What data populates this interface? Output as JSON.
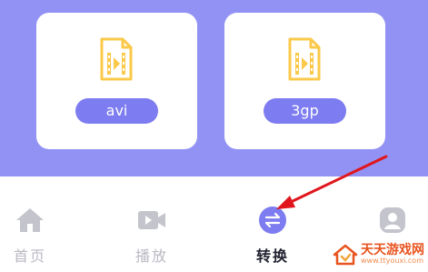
{
  "formats": [
    {
      "label": "avi",
      "icon": "video-file-icon"
    },
    {
      "label": "3gp",
      "icon": "video-file-icon"
    }
  ],
  "tabbar": {
    "items": [
      {
        "label": "首页",
        "icon": "home-icon"
      },
      {
        "label": "播放",
        "icon": "video-camera-icon"
      },
      {
        "label": "转换",
        "icon": "convert-icon",
        "active": true
      },
      {
        "label": "",
        "icon": "profile-icon"
      }
    ]
  },
  "watermark": {
    "text": "天天游戏网",
    "sub": "www.ttyouxi.com"
  },
  "colors": {
    "header_bg": "#9292f4",
    "pill_bg": "#7d7cf0",
    "icon_yellow": "#fbc94a",
    "tab_inactive": "#c4c4cc",
    "tab_active": "#7d7cf0",
    "arrow": "#e0161c"
  }
}
